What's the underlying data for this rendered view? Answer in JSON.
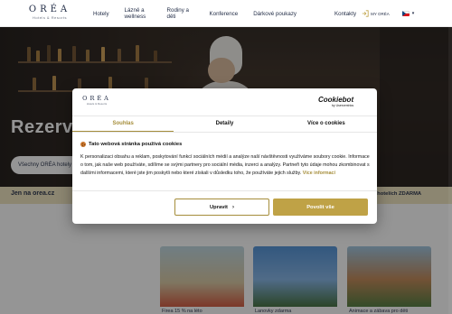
{
  "header": {
    "logo": {
      "word": "ORÉA",
      "tagline": "Hotels & Resorts"
    },
    "nav": [
      {
        "label": "Hotely"
      },
      {
        "label": "Lázně a wellness"
      },
      {
        "label": "Rodiny a děti"
      },
      {
        "label": "Konference"
      },
      {
        "label": "Dárkové poukazy"
      },
      {
        "label": "Kontakty"
      }
    ],
    "account_label": "MY ORÉA",
    "language": "cs"
  },
  "hero": {
    "title": "Rezerv",
    "search_value": "Všechny ORÉA hotely"
  },
  "strip": {
    "left": "Jen na orea.cz",
    "right": "h hotelích ZDARMA"
  },
  "cards": [
    {
      "title": "Firea 15 % na léto"
    },
    {
      "title": "Lanovky zdarma"
    },
    {
      "title": "Animace a zábava pro děti"
    }
  ],
  "cookie_dialog": {
    "logo": {
      "word": "ORÉA",
      "tagline": "Hotels & Resorts"
    },
    "provider": {
      "name": "Cookiebot",
      "sub": "by Usercentrics"
    },
    "tabs": [
      {
        "label": "Souhlas",
        "active": true
      },
      {
        "label": "Detaily",
        "active": false
      },
      {
        "label": "Více o cookies",
        "active": false
      }
    ],
    "heading": "Tato webová stránka používá cookies",
    "body": "K personalizaci obsahu a reklam, poskytování funkcí sociálních médií a analýze naší návštěvnosti využíváme soubory cookie. Informace o tom, jak naše web používáte, sdílíme se svými partnery pro sociální média, inzerci a analýzy. Partneři tyto údaje mohou zkombinovat s dalšími informacemi, které jste jim poskytli nebo které získali v důsledku toho, že používáte jejich služby.",
    "more_link": "Více informací",
    "btn_customize": "Upravit",
    "btn_allow_all": "Povolit vše"
  },
  "colors": {
    "accent": "#bfa246",
    "accent_text": "#a58d3a",
    "navy": "#1f2a44",
    "strip": "#efe3bd"
  }
}
